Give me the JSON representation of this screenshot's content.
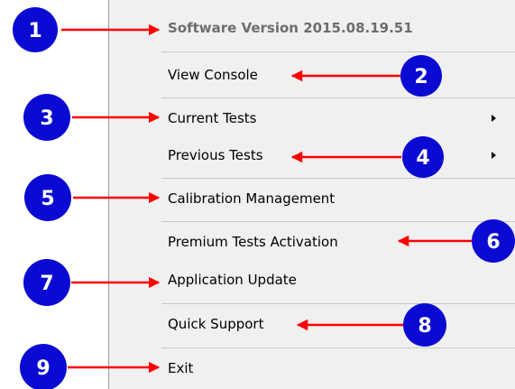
{
  "menu": {
    "items": [
      {
        "label": "Software Version 2015.08.19.51",
        "enabled": false,
        "submenu": false
      },
      {
        "label": "View Console",
        "enabled": true,
        "submenu": false
      },
      {
        "label": "Current Tests",
        "enabled": true,
        "submenu": true
      },
      {
        "label": "Previous Tests",
        "enabled": true,
        "submenu": true
      },
      {
        "label": "Calibration Management",
        "enabled": true,
        "submenu": false
      },
      {
        "label": "Premium Tests Activation",
        "enabled": true,
        "submenu": false
      },
      {
        "label": "Application Update",
        "enabled": true,
        "submenu": false
      },
      {
        "label": "Quick Support",
        "enabled": true,
        "submenu": false
      },
      {
        "label": "Exit",
        "enabled": true,
        "submenu": false
      }
    ]
  },
  "callouts": [
    "1",
    "2",
    "3",
    "4",
    "5",
    "6",
    "7",
    "8",
    "9"
  ],
  "colors": {
    "badge_fill": "#0a0ad2",
    "arrow": "#ff0000",
    "menu_bg": "#f0f0f0"
  }
}
